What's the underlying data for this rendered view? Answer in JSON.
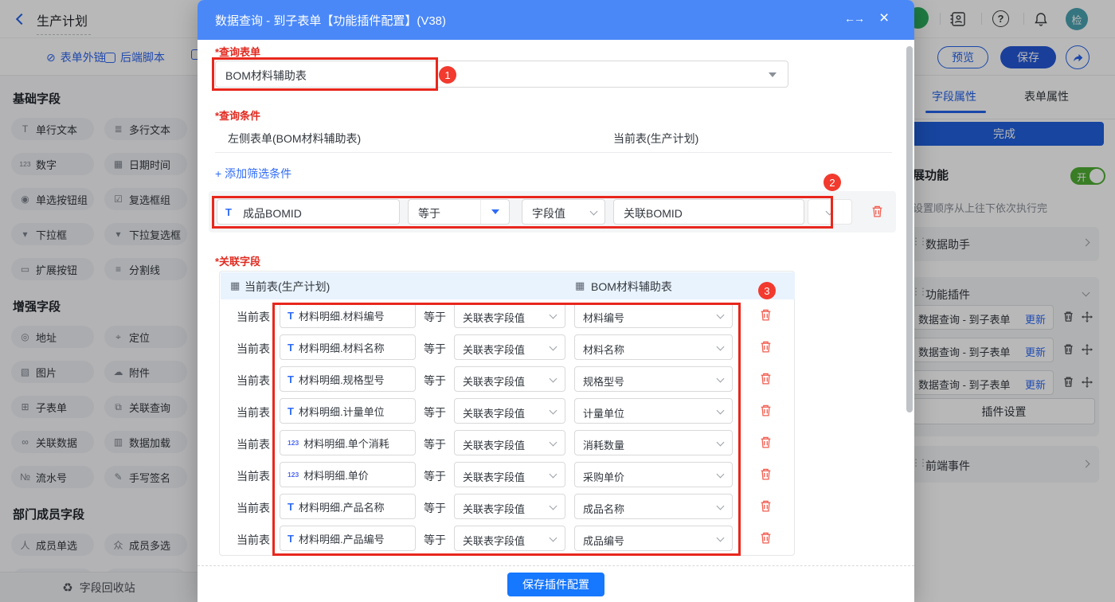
{
  "topbar": {
    "back_label": "生产计划",
    "avatar_text": "检"
  },
  "toolbar": {
    "tabs": [
      {
        "label": "表单外链"
      },
      {
        "label": "后端脚本"
      }
    ],
    "preview_label": "预览",
    "save_label": "保存"
  },
  "sidebar": {
    "sections": [
      {
        "title": "基础字段",
        "items": [
          {
            "icon": "text-icon",
            "label": "单行文本"
          },
          {
            "icon": "multiline-text-icon",
            "label": "多行文本"
          },
          {
            "icon": "number-icon",
            "label": "数字"
          },
          {
            "icon": "datetime-icon",
            "label": "日期时间"
          },
          {
            "icon": "radio-icon",
            "label": "单选按钮组"
          },
          {
            "icon": "checkbox-icon",
            "label": "复选框组"
          },
          {
            "icon": "dropdown-icon",
            "label": "下拉框"
          },
          {
            "icon": "dropdown-multi-icon",
            "label": "下拉复选框"
          },
          {
            "icon": "extend-button-icon",
            "label": "扩展按钮"
          },
          {
            "icon": "divider-icon",
            "label": "分割线"
          }
        ]
      },
      {
        "title": "增强字段",
        "items": [
          {
            "icon": "address-icon",
            "label": "地址"
          },
          {
            "icon": "location-icon",
            "label": "定位"
          },
          {
            "icon": "image-icon",
            "label": "图片"
          },
          {
            "icon": "attachment-icon",
            "label": "附件"
          },
          {
            "icon": "subform-icon",
            "label": "子表单"
          },
          {
            "icon": "lookup-icon",
            "label": "关联查询"
          },
          {
            "icon": "linked-data-icon",
            "label": "关联数据"
          },
          {
            "icon": "data-load-icon",
            "label": "数据加载"
          },
          {
            "icon": "serial-icon",
            "label": "流水号"
          },
          {
            "icon": "signature-icon",
            "label": "手写签名"
          }
        ]
      },
      {
        "title": "部门成员字段",
        "items": [
          {
            "icon": "member-icon",
            "label": "成员单选"
          },
          {
            "icon": "members-icon",
            "label": "成员多选"
          },
          {
            "icon": "",
            "label": ""
          },
          {
            "icon": "",
            "label": ""
          }
        ]
      }
    ],
    "recycle_label": "字段回收站"
  },
  "panel": {
    "tabs": [
      {
        "label": "字段属性"
      },
      {
        "label": "表单属性"
      }
    ],
    "done_label": "完成",
    "ext_title": "展功能",
    "toggle_label": "开",
    "hint": "设置顺序从上往下依次执行完",
    "data_helper_label": "数据助手",
    "plugins_title": "功能插件",
    "plugins": [
      {
        "name": "数据查询 - 到子表单",
        "action": "更新"
      },
      {
        "name": "数据查询 - 到子表单",
        "action": "更新"
      },
      {
        "name": "数据查询 - 到子表单",
        "action": "更新"
      }
    ],
    "plugin_settings_label": "插件设置",
    "frontend_label": "前端事件"
  },
  "modal": {
    "title": "数据查询 - 到子表单【功能插件配置】(V38)",
    "query_form": {
      "label": "*查询表单",
      "value": "BOM材料辅助表",
      "badge": "1"
    },
    "query_condition": {
      "label": "*查询条件",
      "left_header": "左侧表单(BOM材料辅助表)",
      "right_header": "当前表(生产计划)",
      "add_link": "+ 添加筛选条件",
      "badge": "2",
      "field": "成品BOMID",
      "operator": "等于",
      "value_type": "字段值",
      "value": "关联BOMID"
    },
    "related_fields": {
      "label": "*关联字段",
      "left_header": "当前表(生产计划)",
      "right_header": "BOM材料辅助表",
      "badge": "3",
      "row_prefix": "当前表",
      "operator": "等于",
      "value_type": "关联表字段值",
      "rows": [
        {
          "icon": "text-icon",
          "field": "材料明细.材料编号",
          "target": "材料编号"
        },
        {
          "icon": "text-icon",
          "field": "材料明细.材料名称",
          "target": "材料名称"
        },
        {
          "icon": "text-icon",
          "field": "材料明细.规格型号",
          "target": "规格型号"
        },
        {
          "icon": "text-icon",
          "field": "材料明细.计量单位",
          "target": "计量单位"
        },
        {
          "icon": "number-icon",
          "field": "材料明细.单个消耗",
          "target": "消耗数量"
        },
        {
          "icon": "number-icon",
          "field": "材料明细.单价",
          "target": "采购单价"
        },
        {
          "icon": "text-icon",
          "field": "材料明细.产品名称",
          "target": "成品名称"
        },
        {
          "icon": "text-icon",
          "field": "材料明细.产品编号",
          "target": "成品编号"
        }
      ]
    },
    "save_button": "保存插件配置"
  },
  "colors": {
    "modal_header": "#4a88f8",
    "primary_blue": "#1677ff",
    "annotation_red": "#e8271d",
    "toggle_green": "#4fae34"
  }
}
